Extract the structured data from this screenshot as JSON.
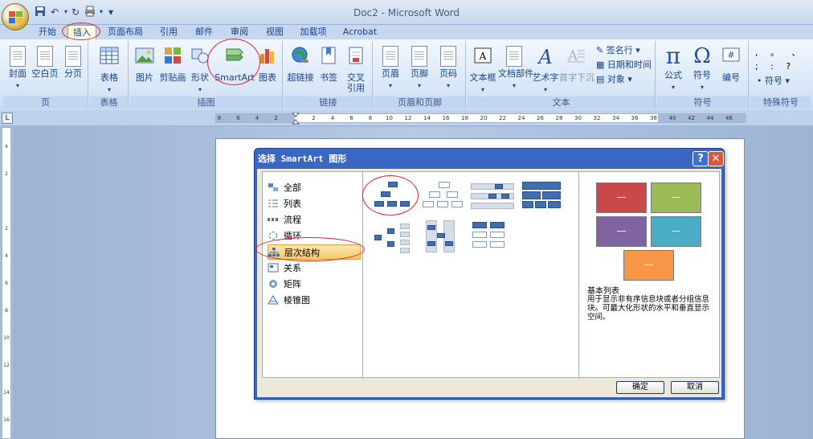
{
  "window": {
    "title": "Doc2 - Microsoft Word"
  },
  "qat": {
    "save": "save-icon",
    "undo": "undo-icon",
    "redo": "redo-icon",
    "print": "print-icon",
    "more": "▾"
  },
  "tabs": [
    "开始",
    "插入",
    "页面布局",
    "引用",
    "邮件",
    "审阅",
    "视图",
    "加载项",
    "Acrobat"
  ],
  "active_tab": "插入",
  "ribbon": {
    "groups": {
      "pages": "页",
      "tables": "表格",
      "illustrations": "插图",
      "links": "链接",
      "header_footer": "页眉和页脚",
      "text": "文本",
      "symbols": "符号",
      "special": "特殊符号"
    },
    "buttons": {
      "cover": "封面",
      "blank": "空白页",
      "page_break": "分页",
      "table": "表格",
      "picture": "图片",
      "clipart": "剪贴画",
      "shapes": "形状",
      "smartart": "SmartArt",
      "chart": "图表",
      "hyperlink": "超链接",
      "bookmark": "书签",
      "crossref": "交叉引用",
      "header": "页眉",
      "footer": "页脚",
      "page_number": "页码",
      "textbox": "文本框",
      "quickparts": "文档部件",
      "wordart": "艺术字",
      "dropcap": "首字下沉",
      "signature": "签名行",
      "datetime": "日期和时间",
      "object": "对象",
      "equation": "公式",
      "symbol": "符号",
      "numbering": "编号",
      "special_symbol": "符号"
    },
    "special_marks": ", 。 、 ; : ?"
  },
  "ruler": {
    "labels": [
      "8",
      "6",
      "4",
      "2",
      "",
      "2",
      "4",
      "6",
      "8",
      "10",
      "12",
      "14",
      "16",
      "18",
      "20",
      "22",
      "24",
      "26",
      "28",
      "30",
      "32",
      "34",
      "36",
      "38",
      "40",
      "42",
      "44",
      "46"
    ],
    "vlabels": [
      "4",
      "2",
      "",
      "2",
      "4",
      "6",
      "8",
      "10",
      "12",
      "14",
      "16",
      "18"
    ]
  },
  "dialog": {
    "title": "选择 SmartArt 图形",
    "help": "?",
    "close": "✕",
    "categories": [
      {
        "label": "全部",
        "icon": "all-icon"
      },
      {
        "label": "列表",
        "icon": "list-icon"
      },
      {
        "label": "流程",
        "icon": "process-icon"
      },
      {
        "label": "循环",
        "icon": "cycle-icon"
      },
      {
        "label": "层次结构",
        "icon": "hierarchy-icon",
        "selected": true
      },
      {
        "label": "关系",
        "icon": "relationship-icon"
      },
      {
        "label": "矩阵",
        "icon": "matrix-icon"
      },
      {
        "label": "棱锥图",
        "icon": "pyramid-icon"
      }
    ],
    "preview": {
      "title": "基本列表",
      "description": "用于显示非有序信息块或者分组信息块。可最大化形状的水平和垂直显示空间。",
      "box_symbol": "—",
      "colors": [
        "#c9494a",
        "#9bbb59",
        "#8064a2",
        "#4bacc6",
        "#f79646"
      ]
    },
    "ok": "确定",
    "cancel": "取消"
  }
}
